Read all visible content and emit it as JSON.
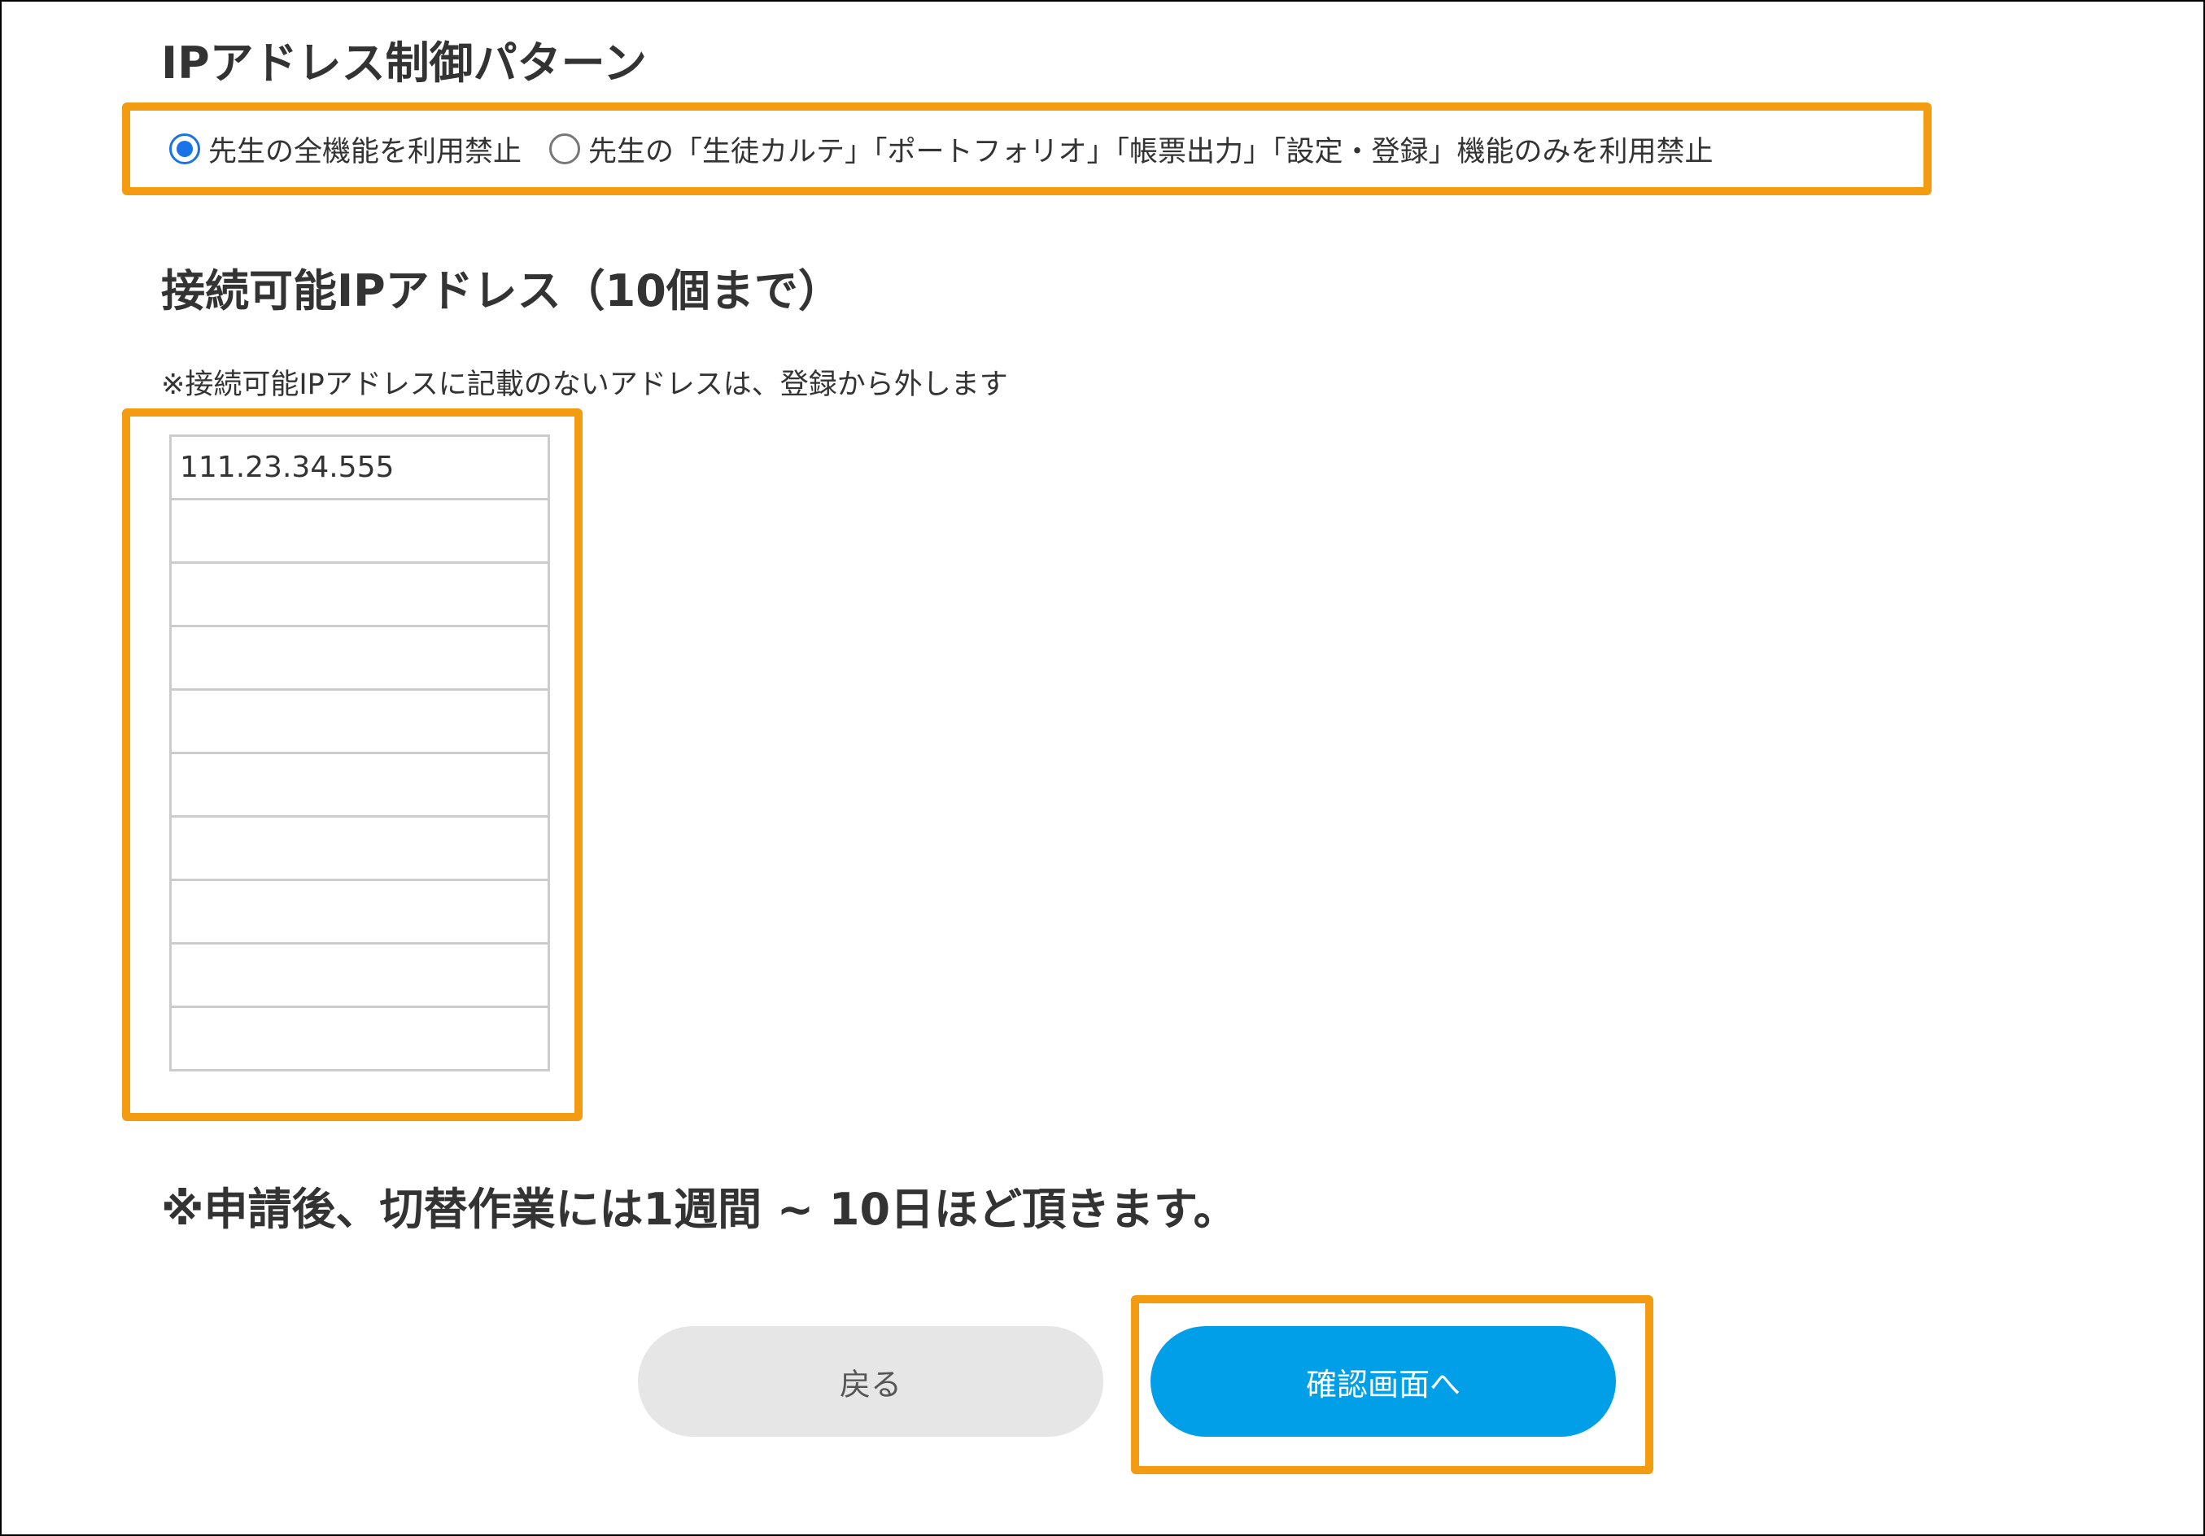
{
  "pattern_section": {
    "title": "IPアドレス制御パターン",
    "options": [
      {
        "label": "先生の全機能を利用禁止",
        "selected": true
      },
      {
        "label": "先生の「生徒カルテ」「ポートフォリオ」「帳票出力」「設定・登録」機能のみを利用禁止",
        "selected": false
      }
    ]
  },
  "ip_section": {
    "title": "接続可能IPアドレス（10個まで）",
    "note": "※接続可能IPアドレスに記載のないアドレスは、登録から外します",
    "addresses": [
      "111.23.34.555",
      "",
      "",
      "",
      "",
      "",
      "",
      "",
      "",
      ""
    ]
  },
  "notice": "※申請後、切替作業には1週間 ~ 10日ほど頂きます。",
  "buttons": {
    "back_label": "戻る",
    "confirm_label": "確認画面へ"
  },
  "colors": {
    "highlight": "#f39c12",
    "primary": "#009fe8",
    "secondary": "#e6e6e6",
    "radio_selected": "#1a73e8"
  }
}
